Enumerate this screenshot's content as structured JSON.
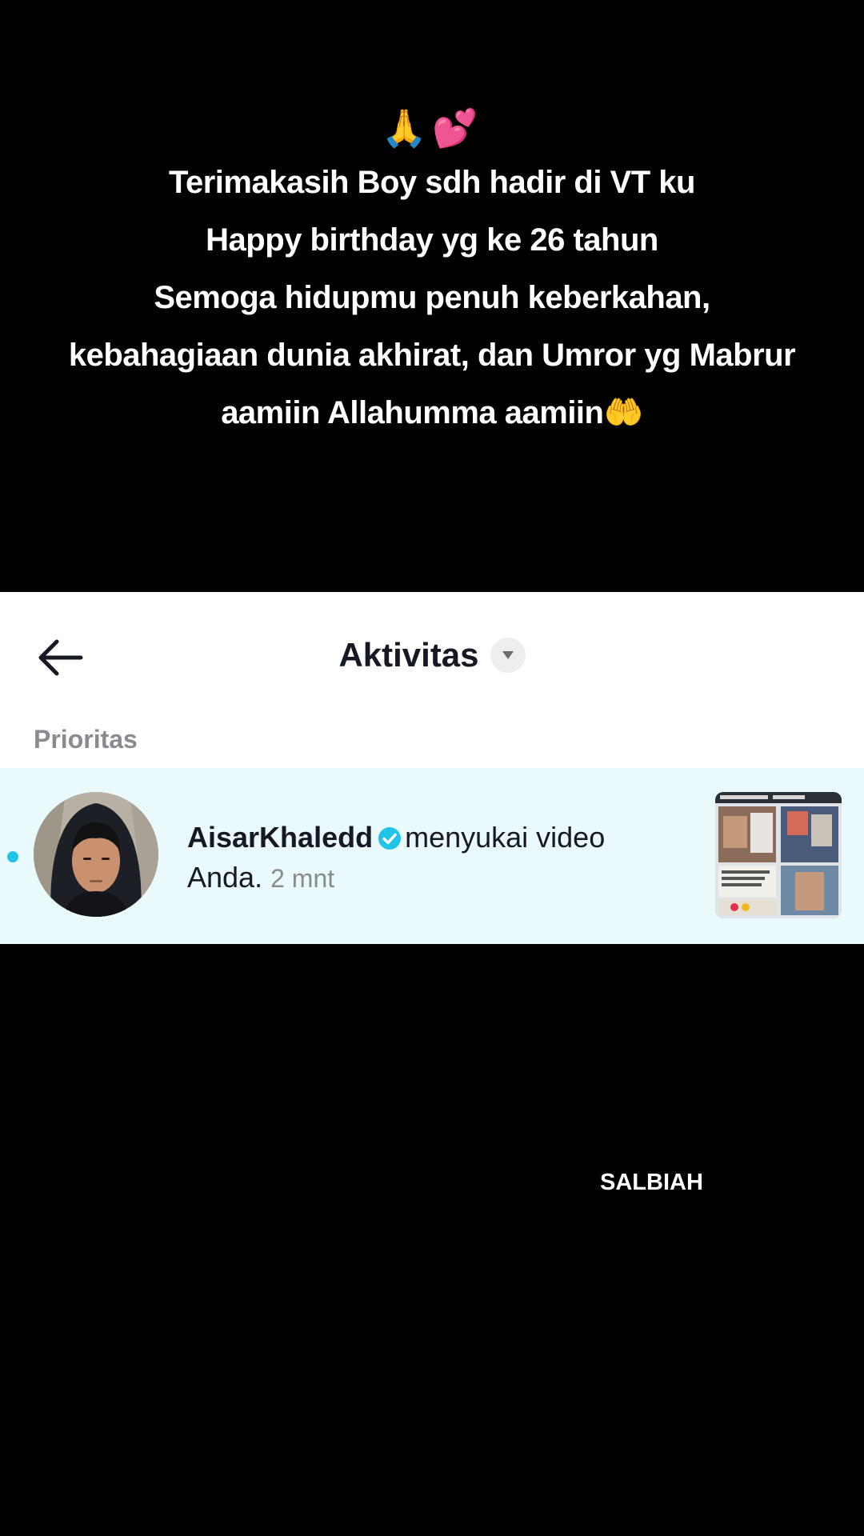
{
  "caption": {
    "emojis": "🙏💕",
    "lines": [
      "Terimakasih Boy sdh hadir di VT ku",
      "Happy birthday yg ke 26 tahun",
      "Semoga hidupmu penuh keberkahan,",
      "kebahagiaan dunia akhirat, dan Umror yg Mabrur"
    ],
    "last_line_text": "aamiin Allahumma aamiin",
    "last_line_emoji": "🤲"
  },
  "header": {
    "title": "Aktivitas",
    "back_icon": "arrow-left-icon",
    "dropdown_icon": "caret-down-icon"
  },
  "section": {
    "label": "Prioritas"
  },
  "notification": {
    "username": "AisarKhaledd",
    "verified": true,
    "action": "menyukai video",
    "object": "Anda.",
    "time": "2 mnt",
    "unread": true,
    "accent_color": "#20c4e8",
    "row_background": "#e9f9fc"
  },
  "watermark": "SALBIAH"
}
